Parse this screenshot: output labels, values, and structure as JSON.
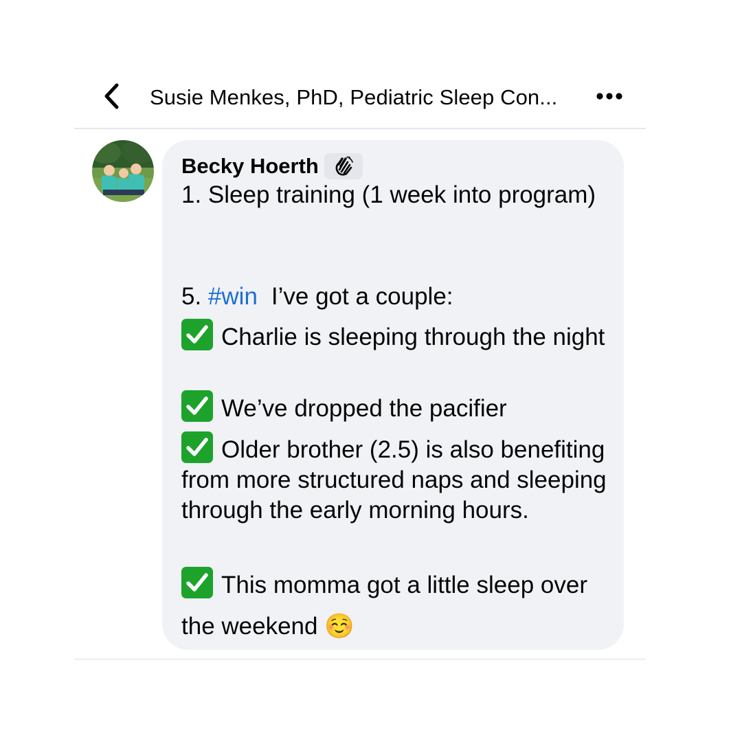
{
  "header": {
    "title": "Susie Menkes, PhD, Pediatric Sleep Con...",
    "back_icon": "chevron-left-icon",
    "more_icon": "more-horizontal-icon"
  },
  "comment": {
    "author": "Becky Hoerth",
    "badge_icon": "waving-hand-icon",
    "line1": "1. Sleep training (1 week into program)",
    "win_prefix": "5. ",
    "hashtag": "#win",
    "win_suffix": "I’ve got a couple:",
    "items": [
      "Charlie is sleeping through the night",
      "We’ve dropped the pacifier",
      "Older brother (2.5) is also benefiting from more structured naps and sleeping through the early morning hours.",
      "This momma got a little sleep over the weekend"
    ],
    "emoji": "☺️",
    "check_icon": "check-mark-box-icon"
  },
  "colors": {
    "bubble": "#f0f2f5",
    "hashtag": "#1b6fd6",
    "check": "#1da32b"
  }
}
